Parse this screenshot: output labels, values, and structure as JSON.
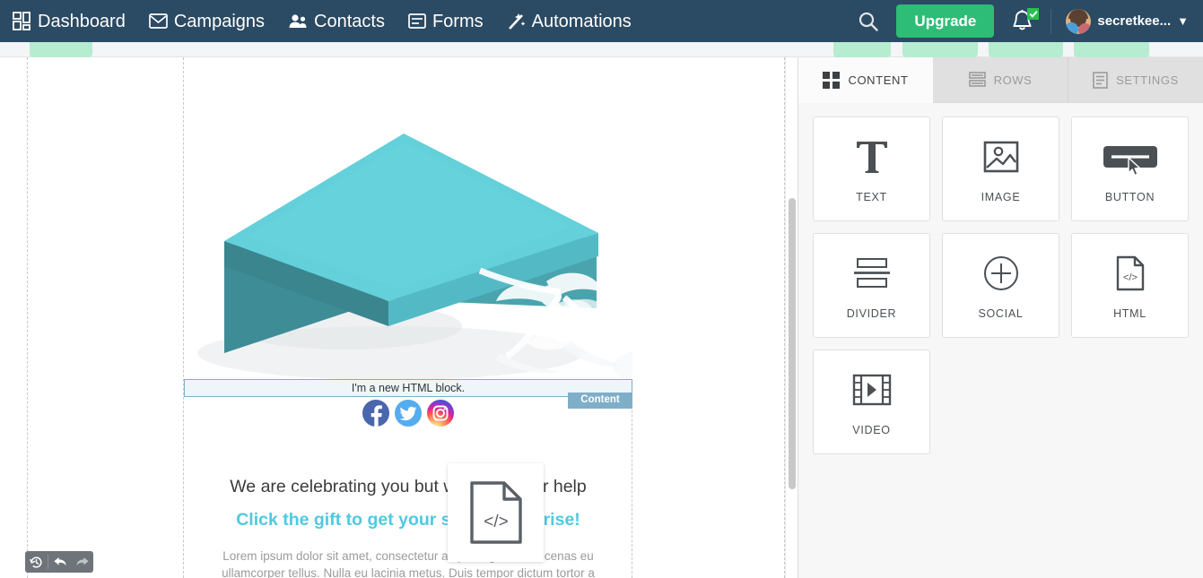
{
  "topnav": {
    "items": [
      {
        "label": "Dashboard",
        "icon": "grid-icon"
      },
      {
        "label": "Campaigns",
        "icon": "envelope-icon"
      },
      {
        "label": "Contacts",
        "icon": "people-icon"
      },
      {
        "label": "Forms",
        "icon": "form-icon"
      },
      {
        "label": "Automations",
        "icon": "wand-icon"
      }
    ],
    "search_icon": "search-icon",
    "upgrade_label": "Upgrade",
    "notifications_icon": "bell-icon",
    "notifications_badge": "check",
    "user_name": "secretkee...",
    "user_chevron": "▼",
    "background_color": "#2b4a63",
    "upgrade_color": "#2ebd76"
  },
  "editor": {
    "email": {
      "image_alt": "turquoise gift box with white ribbon",
      "html_block_text": "I'm a new HTML block.",
      "content_tag_label": "Content",
      "social_icons": [
        "facebook-icon",
        "twitter-icon",
        "instagram-icon"
      ],
      "headline_1": "We are celebrating you but we need your help",
      "headline_2": "Click the gift to get your special surprise!",
      "paragraph": "Lorem ipsum dolor sit amet, consectetur adipiscing elit. Maecenas eu ullamcorper tellus. Nulla eu lacinia metus. Duis tempor dictum tortor a",
      "headline_2_color": "#4ecae0",
      "drop_border_color": "#7fafc8"
    },
    "drag_ghost_icon": "html-file-icon",
    "history_toolbar": [
      {
        "icon": "history-icon"
      },
      {
        "icon": "undo-icon"
      },
      {
        "icon": "redo-icon"
      }
    ]
  },
  "right_panel": {
    "tabs": [
      {
        "label": "CONTENT",
        "icon": "grid-blocks-icon",
        "active": true
      },
      {
        "label": "ROWS",
        "icon": "rows-icon",
        "active": false
      },
      {
        "label": "SETTINGS",
        "icon": "settings-list-icon",
        "active": false
      }
    ],
    "blocks": [
      {
        "label": "TEXT",
        "icon": "text-t-icon"
      },
      {
        "label": "IMAGE",
        "icon": "image-icon"
      },
      {
        "label": "BUTTON",
        "icon": "button-icon"
      },
      {
        "label": "DIVIDER",
        "icon": "divider-icon"
      },
      {
        "label": "SOCIAL",
        "icon": "social-plus-icon"
      },
      {
        "label": "HTML",
        "icon": "html-file-icon"
      },
      {
        "label": "VIDEO",
        "icon": "video-film-icon"
      }
    ]
  }
}
